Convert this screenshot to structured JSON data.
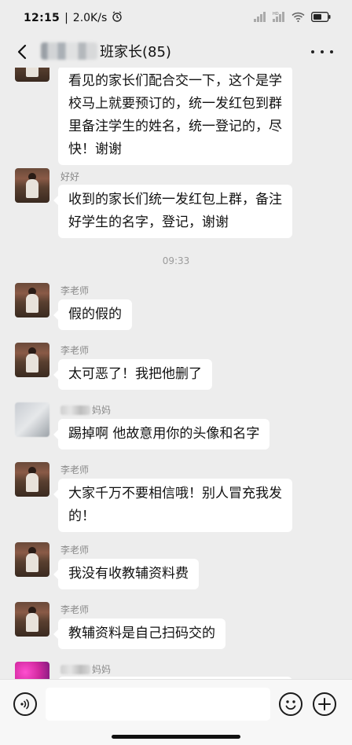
{
  "status_bar": {
    "time": "12:15",
    "network_speed": "2.0K/s",
    "icons": [
      "alarm-icon",
      "signal-icon",
      "signal-icon",
      "wifi-icon",
      "battery-icon"
    ]
  },
  "header": {
    "title_suffix": "班家长(85)",
    "back_icon": "chevron-left-icon",
    "more_icon": "more-icon"
  },
  "messages": [
    {
      "sender": "",
      "text": "看见的家长们配合交一下，这个是学校马上就要预订的，统一发红包到群里备注学生的姓名，统一登记的，尽快！谢谢"
    },
    {
      "sender": "好好",
      "text": "收到的家长们统一发红包上群，备注好学生的名字，登记，谢谢"
    },
    {
      "timestamp": "09:33"
    },
    {
      "sender": "李老师",
      "text": "假的假的"
    },
    {
      "sender": "李老师",
      "text": "太可恶了！我把他删了"
    },
    {
      "sender": "妈妈",
      "text": "踢掉啊 他故意用你的头像和名字"
    },
    {
      "sender": "李老师",
      "text": "大家千万不要相信哦！别人冒充我发的！"
    },
    {
      "sender": "李老师",
      "text": "我没有收教辅资料费"
    },
    {
      "sender": "李老师",
      "text": "教辅资料是自己扫码交的"
    },
    {
      "sender": "妈妈"
    }
  ],
  "input_bar": {
    "value": "",
    "icons": [
      "voice-icon",
      "emoji-icon",
      "plus-icon"
    ]
  },
  "colors": {
    "background": "#ededed",
    "bubble": "#ffffff",
    "sender_name": "#8a8a8a",
    "timestamp": "#9b9b9b"
  }
}
